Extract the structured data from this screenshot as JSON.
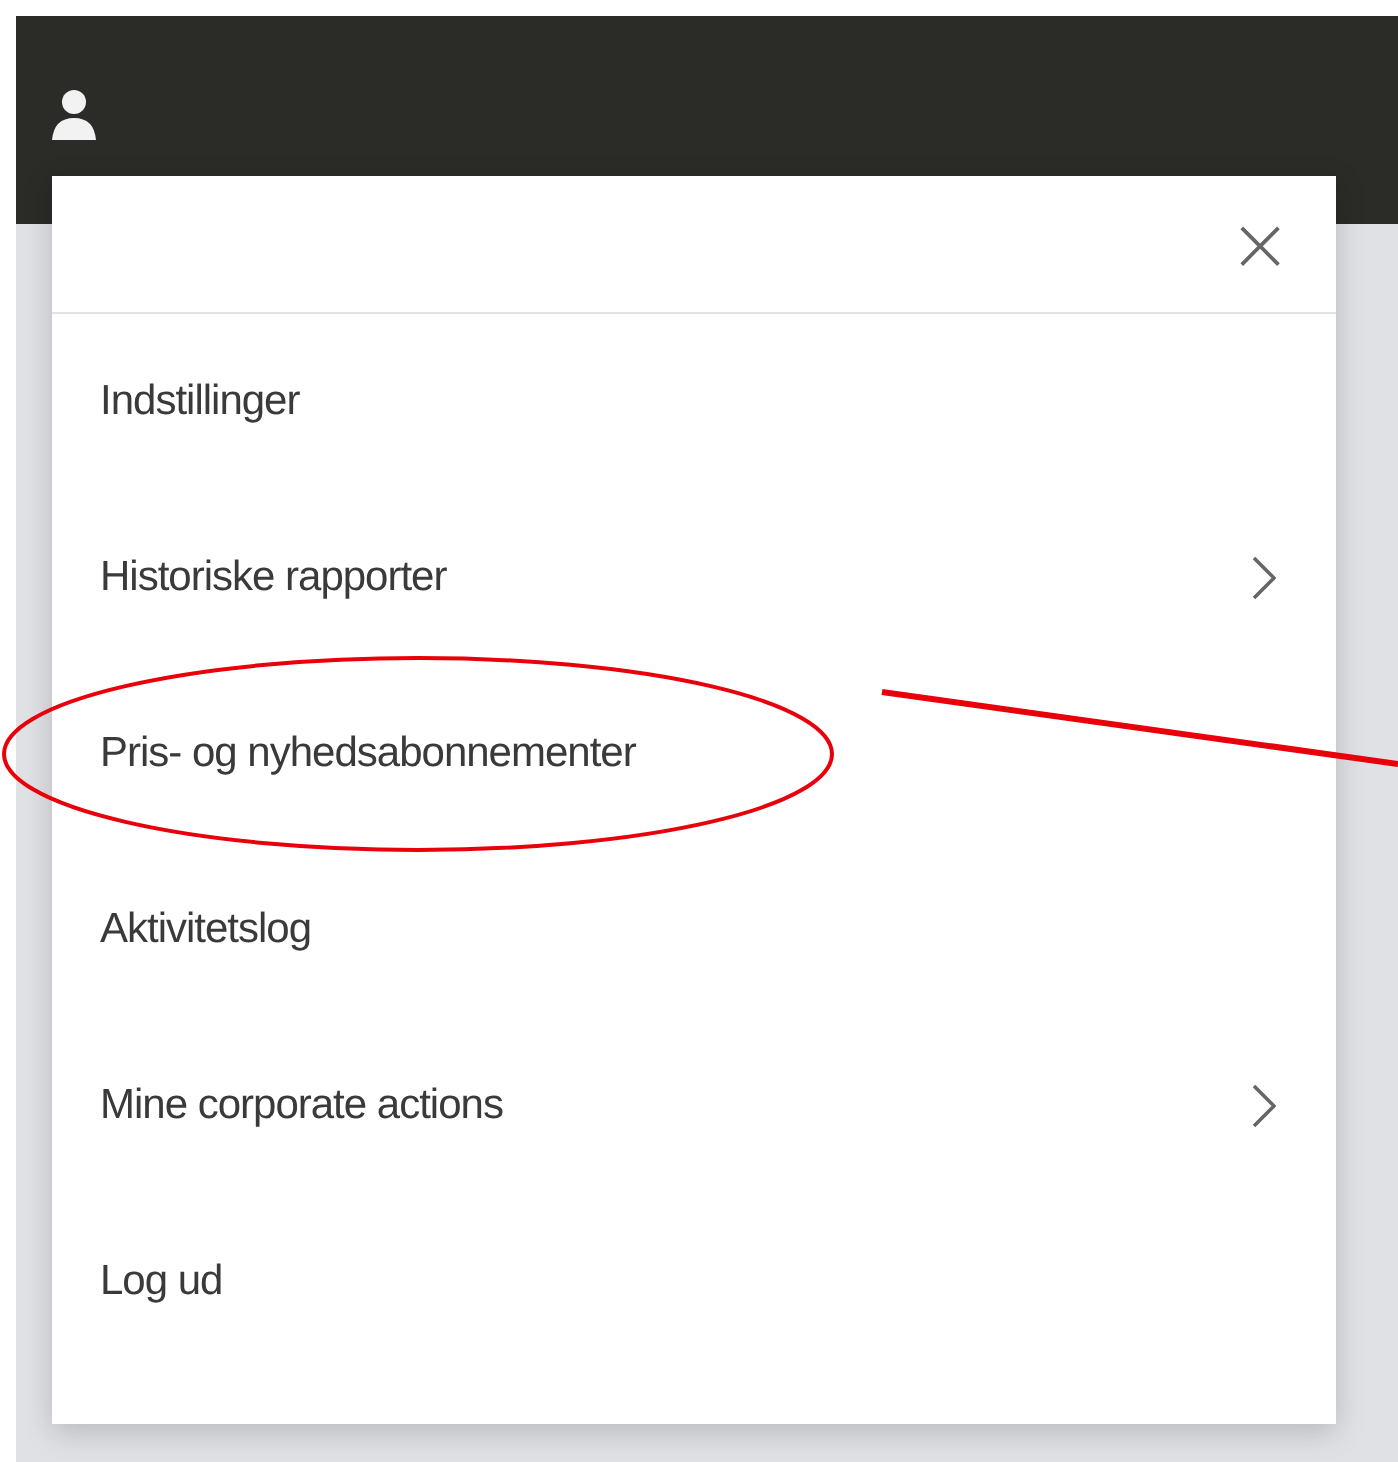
{
  "header": {
    "user_icon": true
  },
  "menu": {
    "close_label": "×",
    "items": [
      {
        "label": "Indstillinger",
        "has_submenu": false,
        "circled": false
      },
      {
        "label": "Historiske rapporter",
        "has_submenu": true,
        "circled": false
      },
      {
        "label": "Pris- og nyhedsabonnementer",
        "has_submenu": false,
        "circled": true
      },
      {
        "label": "Aktivitetslog",
        "has_submenu": false,
        "circled": false
      },
      {
        "label": "Mine corporate actions",
        "has_submenu": true,
        "circled": false
      },
      {
        "label": "Log ud",
        "has_submenu": false,
        "circled": false
      }
    ]
  }
}
